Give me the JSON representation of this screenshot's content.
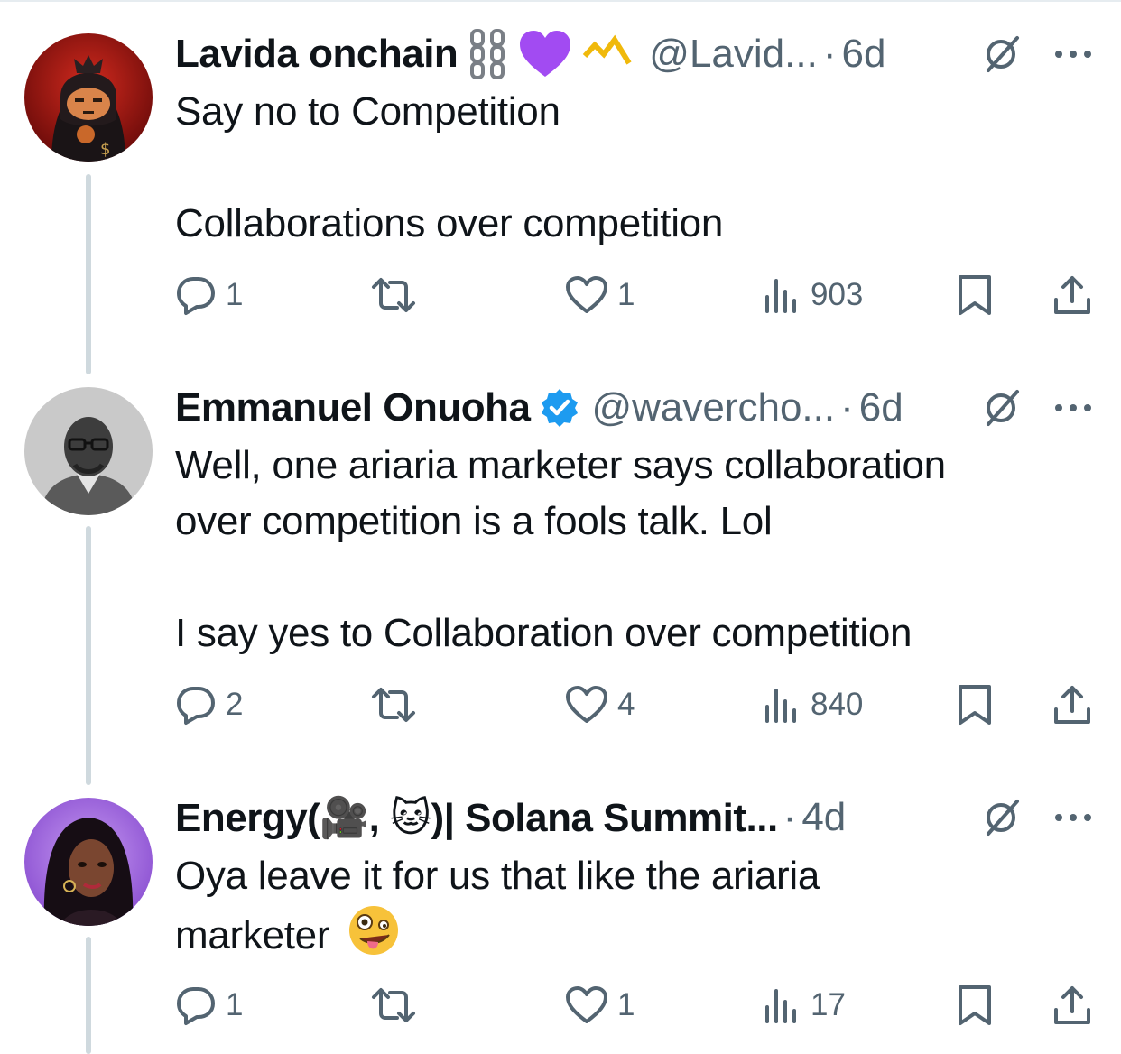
{
  "tweets": [
    {
      "name": "Lavida onchain",
      "handle": "@Lavid...",
      "dot": "·",
      "time": "6d",
      "badges": [
        "chain-emoji",
        "purple-heart-emoji",
        "yellow-check-emoji"
      ],
      "text_lines": [
        "Say no to Competition",
        "",
        "Collaborations over competition"
      ],
      "replies": "1",
      "reposts": "",
      "likes": "1",
      "views": "903"
    },
    {
      "name": "Emmanuel Onuoha",
      "handle": "@wavercho...",
      "dot": "·",
      "time": "6d",
      "badges": [
        "verified-icon"
      ],
      "text_lines": [
        "Well, one ariaria marketer says collaboration",
        "over competition is a fools talk. Lol",
        "",
        "I say yes to Collaboration over competition"
      ],
      "replies": "2",
      "reposts": "",
      "likes": "4",
      "views": "840"
    },
    {
      "name_prefix": "Energy(",
      "name_emoji1": "🎥",
      "name_mid": ",",
      "name_emoji2": "🐱",
      "name_suffix": ")| Solana Summit...",
      "handle": "",
      "dot": "·",
      "time": "4d",
      "text_line1": "Oya leave it  for us that like the ariaria",
      "text_line2": "marketer",
      "text_emoji": "🤪",
      "replies": "1",
      "reposts": "",
      "likes": "1",
      "views": "17"
    }
  ],
  "colors": {
    "text": "#0f1419",
    "secondary": "#536471",
    "thread_line": "#cfd9de",
    "verified": "#1d9bf0",
    "purple_heart": "#a24bf2",
    "yellow": "#f0b90b"
  }
}
